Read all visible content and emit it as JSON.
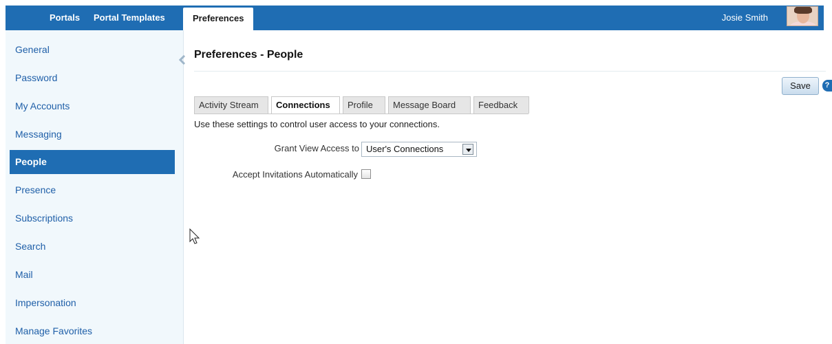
{
  "topbar": {
    "tabs": [
      {
        "label": "Portals"
      },
      {
        "label": "Portal Templates"
      },
      {
        "label": "Preferences"
      }
    ],
    "user_name": "Josie Smith",
    "colors": {
      "bar": "#1f6db3",
      "active_tab_bg": "#ffffff"
    }
  },
  "sidebar": {
    "items": [
      {
        "label": "General"
      },
      {
        "label": "Password"
      },
      {
        "label": "My Accounts"
      },
      {
        "label": "Messaging"
      },
      {
        "label": "People"
      },
      {
        "label": "Presence"
      },
      {
        "label": "Subscriptions"
      },
      {
        "label": "Search"
      },
      {
        "label": "Mail"
      },
      {
        "label": "Impersonation"
      },
      {
        "label": "Manage Favorites"
      }
    ],
    "selected": "People",
    "colors": {
      "bg": "#f1f8fc",
      "link": "#1f5fa8",
      "selected_bg": "#1f6db3"
    }
  },
  "main": {
    "title": "Preferences - People",
    "save_label": "Save",
    "help_label": "?",
    "tabs": [
      {
        "label": "Activity Stream"
      },
      {
        "label": "Connections"
      },
      {
        "label": "Profile"
      },
      {
        "label": "Message Board"
      },
      {
        "label": "Feedback"
      }
    ],
    "selected_tab": "Connections",
    "description": "Use these settings to control user access to your connections.",
    "grant_label": "Grant View Access to",
    "grant_value": "User's Connections",
    "accept_label": "Accept Invitations Automatically",
    "accept_checked": false
  },
  "icons": {
    "collapse": "collapse-arrow-icon",
    "help": "help-icon",
    "dropdown": "chevron-down-icon",
    "cursor": "mouse-pointer-icon"
  }
}
